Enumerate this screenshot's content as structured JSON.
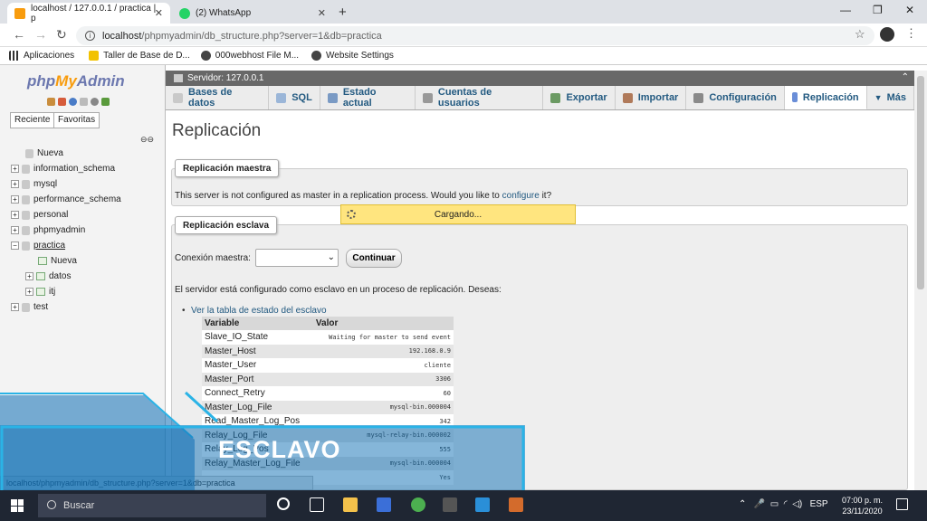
{
  "browser": {
    "tabs": [
      {
        "title": "localhost / 127.0.0.1 / practica | p",
        "icon": "phpmyadmin-favicon"
      },
      {
        "title": "(2) WhatsApp",
        "icon": "whatsapp-favicon"
      }
    ],
    "url_host": "localhost",
    "url_path": "/phpmyadmin/db_structure.php?server=1&db=practica",
    "bookmarks": [
      "Aplicaciones",
      "Taller de Base de D...",
      "000webhost File M...",
      "Website Settings"
    ]
  },
  "pma": {
    "logo_php": "php",
    "logo_my": "My",
    "logo_admin": "Admin",
    "left_tabs": [
      "Reciente",
      "Favoritas"
    ],
    "tree": {
      "nueva": "Nueva",
      "dbs": [
        "information_schema",
        "mysql",
        "performance_schema",
        "personal",
        "phpmyadmin"
      ],
      "practica": "practica",
      "practica_new": "Nueva",
      "practica_tables": [
        "datos",
        "itj"
      ],
      "test": "test"
    },
    "server_bar": "Servidor: 127.0.0.1",
    "menu": [
      "Bases de datos",
      "SQL",
      "Estado actual",
      "Cuentas de usuarios",
      "Exportar",
      "Importar",
      "Configuración",
      "Replicación",
      "Más"
    ],
    "page_title": "Replicación",
    "master_legend": "Replicación maestra",
    "master_msg_pre": "This server is not configured as master in a replication process. Would you like to ",
    "master_msg_link": "configure",
    "master_msg_post": " it?",
    "loading": "Cargando...",
    "slave_legend": "Replicación esclava",
    "conn_label": "Conexión maestra:",
    "continue_btn": "Continuar",
    "slave_msg": "El servidor está configurado como esclavo en un proceso de replicación. Deseas:",
    "slave_link": "Ver la tabla de estado del esclavo",
    "table_headers": [
      "Variable",
      "Valor"
    ],
    "table_rows": [
      [
        "Slave_IO_State",
        "Waiting for master to send event"
      ],
      [
        "Master_Host",
        "192.168.0.9"
      ],
      [
        "Master_User",
        "cliente"
      ],
      [
        "Master_Port",
        "3306"
      ],
      [
        "Connect_Retry",
        "60"
      ],
      [
        "Master_Log_File",
        "mysql-bin.000004"
      ],
      [
        "Read_Master_Log_Pos",
        "342"
      ],
      [
        "Relay_Log_File",
        "mysql-relay-bin.000002"
      ],
      [
        "Relay_Log_Pos",
        "555"
      ],
      [
        "Relay_Master_Log_File",
        "mysql-bin.000004"
      ],
      [
        "",
        "Yes"
      ]
    ],
    "status_url": "localhost/phpmyadmin/db_structure.php?server=1&db=practica"
  },
  "overlay": {
    "caption": "ESCLAVO",
    "color": "#2ab3e6"
  },
  "taskbar": {
    "search": "Buscar",
    "language": "ESP",
    "time": "07:00 p. m.",
    "date": "23/11/2020"
  }
}
